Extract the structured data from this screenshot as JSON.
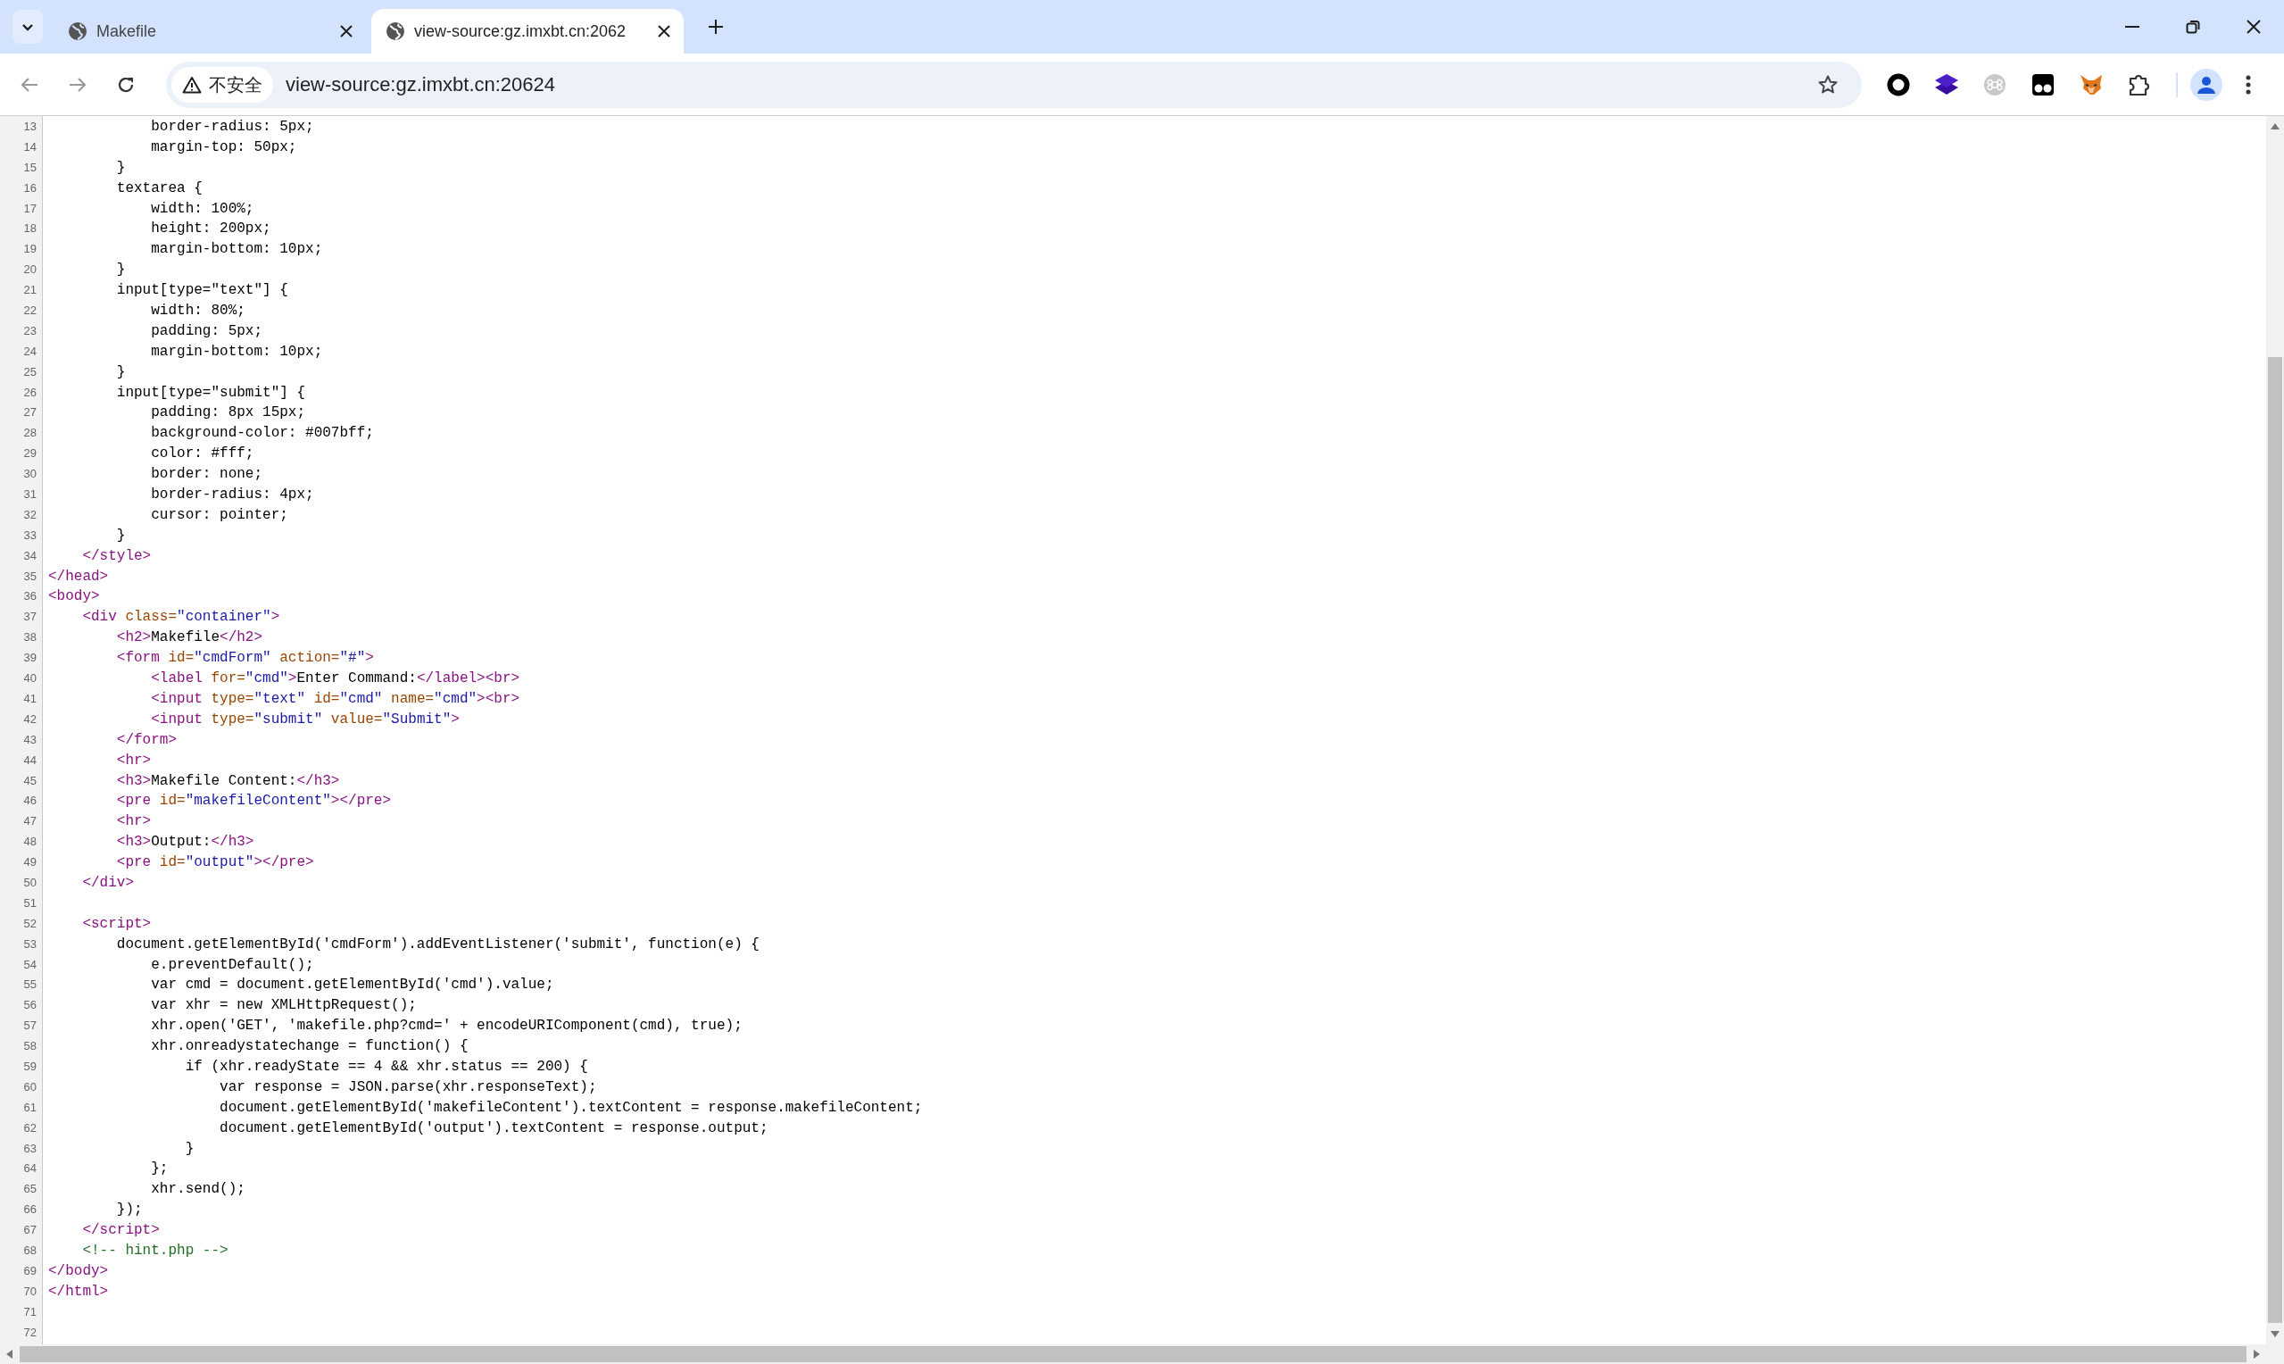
{
  "tabs": [
    {
      "title": "Makefile",
      "selected": false
    },
    {
      "title": "view-source:gz.imxbt.cn:2062",
      "selected": true
    }
  ],
  "address_bar": {
    "security_label": "不安全",
    "url": "view-source:gz.imxbt.cn:20624"
  },
  "source_lines": [
    {
      "number": "13",
      "tokens": [
        {
          "kind": "text",
          "text": "            border-radius: 5px;"
        }
      ]
    },
    {
      "number": "14",
      "tokens": [
        {
          "kind": "text",
          "text": "            margin-top: 50px;"
        }
      ]
    },
    {
      "number": "15",
      "tokens": [
        {
          "kind": "text",
          "text": "        }"
        }
      ]
    },
    {
      "number": "16",
      "tokens": [
        {
          "kind": "text",
          "text": "        textarea {"
        }
      ]
    },
    {
      "number": "17",
      "tokens": [
        {
          "kind": "text",
          "text": "            width: 100%;"
        }
      ]
    },
    {
      "number": "18",
      "tokens": [
        {
          "kind": "text",
          "text": "            height: 200px;"
        }
      ]
    },
    {
      "number": "19",
      "tokens": [
        {
          "kind": "text",
          "text": "            margin-bottom: 10px;"
        }
      ]
    },
    {
      "number": "20",
      "tokens": [
        {
          "kind": "text",
          "text": "        }"
        }
      ]
    },
    {
      "number": "21",
      "tokens": [
        {
          "kind": "text",
          "text": "        input[type=\"text\"] {"
        }
      ]
    },
    {
      "number": "22",
      "tokens": [
        {
          "kind": "text",
          "text": "            width: 80%;"
        }
      ]
    },
    {
      "number": "23",
      "tokens": [
        {
          "kind": "text",
          "text": "            padding: 5px;"
        }
      ]
    },
    {
      "number": "24",
      "tokens": [
        {
          "kind": "text",
          "text": "            margin-bottom: 10px;"
        }
      ]
    },
    {
      "number": "25",
      "tokens": [
        {
          "kind": "text",
          "text": "        }"
        }
      ]
    },
    {
      "number": "26",
      "tokens": [
        {
          "kind": "text",
          "text": "        input[type=\"submit\"] {"
        }
      ]
    },
    {
      "number": "27",
      "tokens": [
        {
          "kind": "text",
          "text": "            padding: 8px 15px;"
        }
      ]
    },
    {
      "number": "28",
      "tokens": [
        {
          "kind": "text",
          "text": "            background-color: #007bff;"
        }
      ]
    },
    {
      "number": "29",
      "tokens": [
        {
          "kind": "text",
          "text": "            color: #fff;"
        }
      ]
    },
    {
      "number": "30",
      "tokens": [
        {
          "kind": "text",
          "text": "            border: none;"
        }
      ]
    },
    {
      "number": "31",
      "tokens": [
        {
          "kind": "text",
          "text": "            border-radius: 4px;"
        }
      ]
    },
    {
      "number": "32",
      "tokens": [
        {
          "kind": "text",
          "text": "            cursor: pointer;"
        }
      ]
    },
    {
      "number": "33",
      "tokens": [
        {
          "kind": "text",
          "text": "        }"
        }
      ]
    },
    {
      "number": "34",
      "tokens": [
        {
          "kind": "tag",
          "text": "    </style>"
        }
      ]
    },
    {
      "number": "35",
      "tokens": [
        {
          "kind": "tag",
          "text": "</head>"
        }
      ]
    },
    {
      "number": "36",
      "tokens": [
        {
          "kind": "tag",
          "text": "<body>"
        }
      ]
    },
    {
      "number": "37",
      "tokens": [
        {
          "kind": "tag",
          "text": "    <div"
        },
        {
          "kind": "attribute",
          "text": " class="
        },
        {
          "kind": "value",
          "text": "\"container\""
        },
        {
          "kind": "tag",
          "text": ">"
        }
      ]
    },
    {
      "number": "38",
      "tokens": [
        {
          "kind": "tag",
          "text": "        <h2>"
        },
        {
          "kind": "text",
          "text": "Makefile"
        },
        {
          "kind": "tag",
          "text": "</h2>"
        }
      ]
    },
    {
      "number": "39",
      "tokens": [
        {
          "kind": "tag",
          "text": "        <form"
        },
        {
          "kind": "attribute",
          "text": " id="
        },
        {
          "kind": "value",
          "text": "\"cmdForm\""
        },
        {
          "kind": "attribute",
          "text": " action="
        },
        {
          "kind": "value",
          "text": "\"#\""
        },
        {
          "kind": "tag",
          "text": ">"
        }
      ]
    },
    {
      "number": "40",
      "tokens": [
        {
          "kind": "tag",
          "text": "            <label"
        },
        {
          "kind": "attribute",
          "text": " for="
        },
        {
          "kind": "value",
          "text": "\"cmd\""
        },
        {
          "kind": "tag",
          "text": ">"
        },
        {
          "kind": "text",
          "text": "Enter Command:"
        },
        {
          "kind": "tag",
          "text": "</label><br>"
        }
      ]
    },
    {
      "number": "41",
      "tokens": [
        {
          "kind": "tag",
          "text": "            <input"
        },
        {
          "kind": "attribute",
          "text": " type="
        },
        {
          "kind": "value",
          "text": "\"text\""
        },
        {
          "kind": "attribute",
          "text": " id="
        },
        {
          "kind": "value",
          "text": "\"cmd\""
        },
        {
          "kind": "attribute",
          "text": " name="
        },
        {
          "kind": "value",
          "text": "\"cmd\""
        },
        {
          "kind": "tag",
          "text": "><br>"
        }
      ]
    },
    {
      "number": "42",
      "tokens": [
        {
          "kind": "tag",
          "text": "            <input"
        },
        {
          "kind": "attribute",
          "text": " type="
        },
        {
          "kind": "value",
          "text": "\"submit\""
        },
        {
          "kind": "attribute",
          "text": " value="
        },
        {
          "kind": "value",
          "text": "\"Submit\""
        },
        {
          "kind": "tag",
          "text": ">"
        }
      ]
    },
    {
      "number": "43",
      "tokens": [
        {
          "kind": "tag",
          "text": "        </form>"
        }
      ]
    },
    {
      "number": "44",
      "tokens": [
        {
          "kind": "tag",
          "text": "        <hr>"
        }
      ]
    },
    {
      "number": "45",
      "tokens": [
        {
          "kind": "tag",
          "text": "        <h3>"
        },
        {
          "kind": "text",
          "text": "Makefile Content:"
        },
        {
          "kind": "tag",
          "text": "</h3>"
        }
      ]
    },
    {
      "number": "46",
      "tokens": [
        {
          "kind": "tag",
          "text": "        <pre"
        },
        {
          "kind": "attribute",
          "text": " id="
        },
        {
          "kind": "value",
          "text": "\"makefileContent\""
        },
        {
          "kind": "tag",
          "text": "></pre>"
        }
      ]
    },
    {
      "number": "47",
      "tokens": [
        {
          "kind": "tag",
          "text": "        <hr>"
        }
      ]
    },
    {
      "number": "48",
      "tokens": [
        {
          "kind": "tag",
          "text": "        <h3>"
        },
        {
          "kind": "text",
          "text": "Output:"
        },
        {
          "kind": "tag",
          "text": "</h3>"
        }
      ]
    },
    {
      "number": "49",
      "tokens": [
        {
          "kind": "tag",
          "text": "        <pre"
        },
        {
          "kind": "attribute",
          "text": " id="
        },
        {
          "kind": "value",
          "text": "\"output\""
        },
        {
          "kind": "tag",
          "text": "></pre>"
        }
      ]
    },
    {
      "number": "50",
      "tokens": [
        {
          "kind": "tag",
          "text": "    </div>"
        }
      ]
    },
    {
      "number": "51"
    },
    {
      "number": "52",
      "tokens": [
        {
          "kind": "tag",
          "text": "    <script>"
        }
      ]
    },
    {
      "number": "53",
      "tokens": [
        {
          "kind": "text",
          "text": "        document.getElementById('cmdForm').addEventListener('submit', function(e) {"
        }
      ]
    },
    {
      "number": "54",
      "tokens": [
        {
          "kind": "text",
          "text": "            e.preventDefault();"
        }
      ]
    },
    {
      "number": "55",
      "tokens": [
        {
          "kind": "text",
          "text": "            var cmd = document.getElementById('cmd').value;"
        }
      ]
    },
    {
      "number": "56",
      "tokens": [
        {
          "kind": "text",
          "text": "            var xhr = new XMLHttpRequest();"
        }
      ]
    },
    {
      "number": "57",
      "tokens": [
        {
          "kind": "text",
          "text": "            xhr.open('GET', 'makefile.php?cmd=' + encodeURIComponent(cmd), true);"
        }
      ]
    },
    {
      "number": "58",
      "tokens": [
        {
          "kind": "text",
          "text": "            xhr.onreadystatechange = function() {"
        }
      ]
    },
    {
      "number": "59",
      "tokens": [
        {
          "kind": "text",
          "text": "                if (xhr.readyState == 4 && xhr.status == 200) {"
        }
      ]
    },
    {
      "number": "60",
      "tokens": [
        {
          "kind": "text",
          "text": "                    var response = JSON.parse(xhr.responseText);"
        }
      ]
    },
    {
      "number": "61",
      "tokens": [
        {
          "kind": "text",
          "text": "                    document.getElementById('makefileContent').textContent = response.makefileContent;"
        }
      ]
    },
    {
      "number": "62",
      "tokens": [
        {
          "kind": "text",
          "text": "                    document.getElementById('output').textContent = response.output;"
        }
      ]
    },
    {
      "number": "63",
      "tokens": [
        {
          "kind": "text",
          "text": "                }"
        }
      ]
    },
    {
      "number": "64",
      "tokens": [
        {
          "kind": "text",
          "text": "            };"
        }
      ]
    },
    {
      "number": "65",
      "tokens": [
        {
          "kind": "text",
          "text": "            xhr.send();"
        }
      ]
    },
    {
      "number": "66",
      "tokens": [
        {
          "kind": "text",
          "text": "        });"
        }
      ]
    },
    {
      "number": "67",
      "tokens": [
        {
          "kind": "tag",
          "text": "    </script>"
        }
      ]
    },
    {
      "number": "68",
      "tokens": [
        {
          "kind": "comment",
          "text": "    <!-- hint.php -->"
        }
      ]
    },
    {
      "number": "69",
      "tokens": [
        {
          "kind": "tag",
          "text": "</body>"
        }
      ]
    },
    {
      "number": "70",
      "tokens": [
        {
          "kind": "tag",
          "text": "</html>"
        }
      ]
    },
    {
      "number": "71"
    },
    {
      "number": "72"
    }
  ]
}
